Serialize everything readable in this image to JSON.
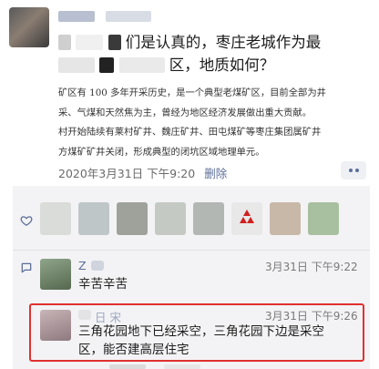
{
  "post": {
    "title": "干我们是认真的，枣庄老城作为最……区，地质如何？",
    "title_line1_tail": "们是认真的，枣庄老城作为最",
    "title_line2_tail": "区，地质如何？",
    "excerpt": [
      "矿区有 100 多年开采历史，是一个典型老煤矿区，目前全部为井",
      "采、气煤和天然焦为主，曾经为地区经济发展做出重大贡献。",
      "村开始陆续有莱村矿井、魏庄矿井、田屯煤矿等枣庄集团属矿井",
      "方煤矿矿井关闭，形成典型的闭坑区域地理单元。"
    ],
    "timestamp": "2020年3月31日 下午9:20",
    "delete_label": "删除"
  },
  "likes": {
    "thumb_colors": [
      "#d9dcd8",
      "#bfc6c8",
      "#9ea29b",
      "#c4c9c4",
      "#b2b7b4",
      "#e8e8e8",
      "#c8b8a8",
      "#ddd6cc",
      "#a8c0a0"
    ]
  },
  "comments": [
    {
      "name": "Z",
      "time": "3月31日 下午9:22",
      "text": "辛苦辛苦"
    },
    {
      "name": "日 宋",
      "time": "3月31日 下午9:26",
      "text_line1": "三角花园地下已经采空，三角花园下边是采空",
      "text_line2": "区，能否建高层住宅"
    }
  ],
  "colors": {
    "link": "#5c6f99",
    "highlight": "#e03030",
    "comment_bg": "#f3f3f5"
  }
}
